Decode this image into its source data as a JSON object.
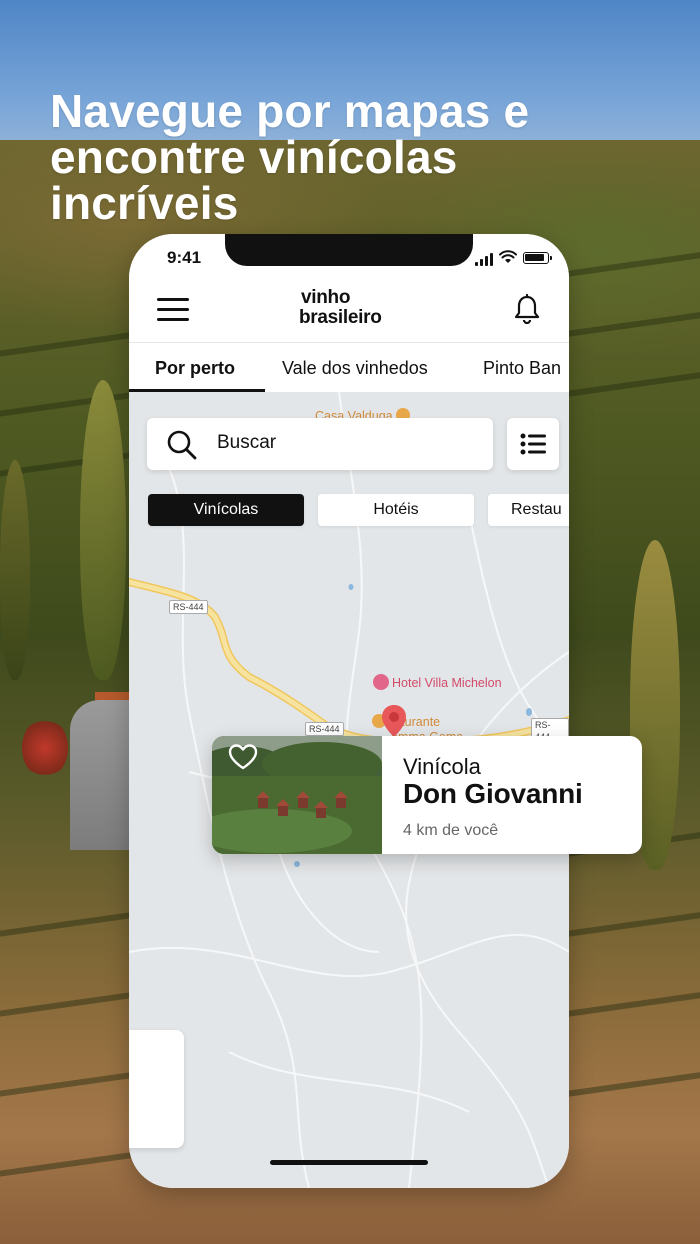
{
  "headline": {
    "line1": "Navegue por mapas e",
    "line2": "encontre vinícolas",
    "line3": "incríveis"
  },
  "status_bar": {
    "time": "9:41",
    "icons": [
      "cellular-signal-icon",
      "wifi-icon",
      "battery-icon"
    ]
  },
  "app_bar": {
    "menu_icon": "hamburger-menu-icon",
    "logo_line1": "vinho",
    "logo_line2": "brasileiro",
    "notification_icon": "bell-icon"
  },
  "tabs": [
    {
      "label": "Por perto",
      "active": true
    },
    {
      "label": "Vale dos vinhedos",
      "active": false
    },
    {
      "label": "Pinto Ban",
      "active": false
    }
  ],
  "search": {
    "placeholder": "Buscar",
    "icon": "search-icon",
    "list_view_icon": "list-view-icon"
  },
  "filters": [
    {
      "label": "Vinícolas",
      "active": true
    },
    {
      "label": "Hotéis",
      "active": false
    },
    {
      "label": "Restau",
      "active": false
    }
  ],
  "map": {
    "places": [
      {
        "name": "Casa Valduga",
        "icon": "wine-glass-icon"
      },
      {
        "name": "Hotel Villa Michelon",
        "icon": "bed-icon"
      },
      {
        "name": "staurante",
        "icon": "restaurant-icon"
      },
      {
        "name": "amma Gema",
        "icon": ""
      }
    ],
    "road_badges": [
      "RS-444",
      "RS-444",
      "RS-444"
    ],
    "selected_pin_icon": "location-pin-icon"
  },
  "winery_card": {
    "favorite_icon": "heart-outline-icon",
    "subtitle": "Vinícola",
    "title": "Don Giovanni",
    "distance": "4 km de você"
  },
  "colors": {
    "accent_pin": "#e8585a",
    "place_label_orange": "#d08a3a",
    "hotel_label_red": "#d14b6a",
    "map_background": "#e3e6e8",
    "road": "#f5df8c"
  }
}
